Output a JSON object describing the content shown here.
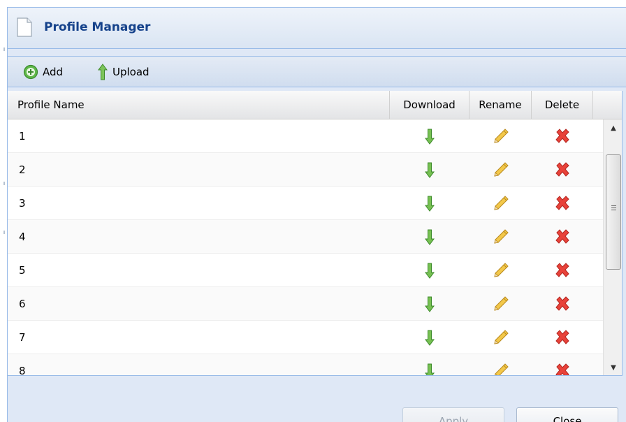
{
  "dialog": {
    "title": "Profile Manager",
    "title_color": "#15428b"
  },
  "toolbar": {
    "add_label": "Add",
    "upload_label": "Upload"
  },
  "grid": {
    "columns": [
      "Profile Name",
      "Download",
      "Rename",
      "Delete"
    ],
    "rows": [
      {
        "name": "1"
      },
      {
        "name": "2"
      },
      {
        "name": "3"
      },
      {
        "name": "4"
      },
      {
        "name": "5"
      },
      {
        "name": "6"
      },
      {
        "name": "7"
      },
      {
        "name": "8"
      }
    ],
    "row_icons": {
      "download": "arrow-down-green-icon",
      "rename": "pencil-icon",
      "delete": "red-x-icon"
    }
  },
  "footer": {
    "apply_label": "Apply",
    "apply_disabled": true,
    "close_label": "Close"
  }
}
